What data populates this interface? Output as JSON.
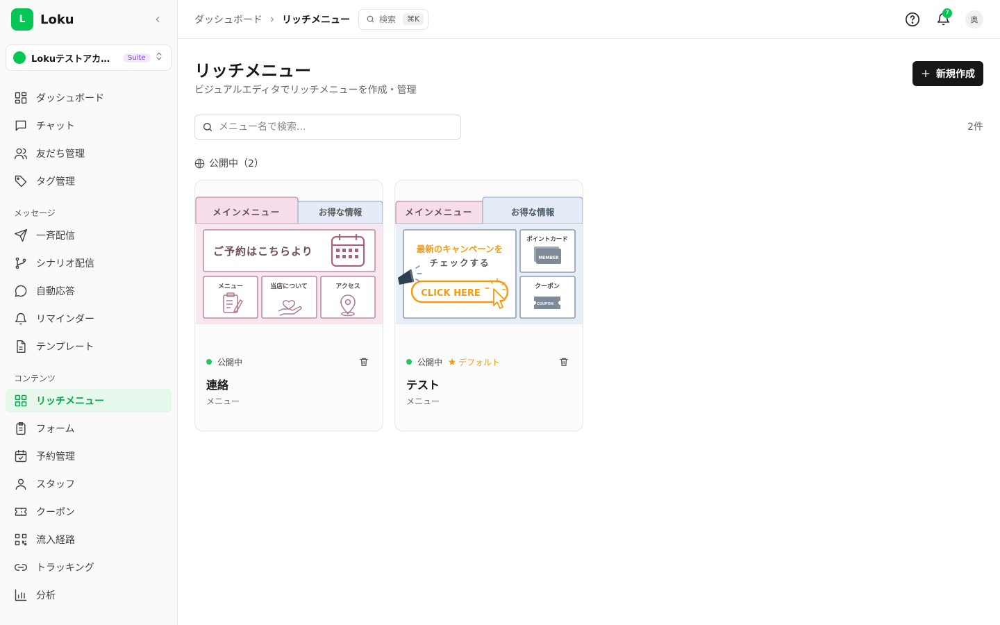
{
  "brand": {
    "logo_letter": "L",
    "name": "Loku"
  },
  "account": {
    "name": "Lokuテストアカウント",
    "badge": "Suite"
  },
  "sidebar": {
    "main_items": [
      {
        "label": "ダッシュボード",
        "icon": "dashboard-icon"
      },
      {
        "label": "チャット",
        "icon": "chat-icon"
      },
      {
        "label": "友だち管理",
        "icon": "users-icon"
      },
      {
        "label": "タグ管理",
        "icon": "tag-icon"
      }
    ],
    "message_section": "メッセージ",
    "message_items": [
      {
        "label": "一斉配信",
        "icon": "send-icon"
      },
      {
        "label": "シナリオ配信",
        "icon": "scenario-icon"
      },
      {
        "label": "自動応答",
        "icon": "auto-reply-icon"
      },
      {
        "label": "リマインダー",
        "icon": "bell-icon"
      },
      {
        "label": "テンプレート",
        "icon": "template-icon"
      }
    ],
    "content_section": "コンテンツ",
    "content_items": [
      {
        "label": "リッチメニュー",
        "icon": "rich-menu-icon",
        "active": true
      },
      {
        "label": "フォーム",
        "icon": "form-icon"
      },
      {
        "label": "予約管理",
        "icon": "calendar-icon"
      },
      {
        "label": "スタッフ",
        "icon": "staff-icon"
      },
      {
        "label": "クーポン",
        "icon": "coupon-icon"
      },
      {
        "label": "流入経路",
        "icon": "qr-icon"
      },
      {
        "label": "トラッキング",
        "icon": "link-icon"
      },
      {
        "label": "分析",
        "icon": "chart-icon"
      }
    ]
  },
  "header": {
    "breadcrumb_parent": "ダッシュボード",
    "breadcrumb_current": "リッチメニュー",
    "search_label": "検索",
    "search_shortcut": "⌘K",
    "notification_count": "7",
    "avatar_initial": "奥"
  },
  "page": {
    "title": "リッチメニュー",
    "subtitle": "ビジュアルエディタでリッチメニューを作成・管理",
    "new_button": "新規作成",
    "search_placeholder": "メニュー名で検索...",
    "count": "2件",
    "section_label": "公開中（2）"
  },
  "cards": [
    {
      "status": "公開中",
      "name": "連絡",
      "type": "メニュー",
      "preview": {
        "tab_left": "メインメニュー",
        "tab_right": "お得な情報",
        "banner": "ご予約はこちらより",
        "cells": [
          "メニュー",
          "当店について",
          "アクセス"
        ]
      }
    },
    {
      "status": "公開中",
      "default_label": "デフォルト",
      "name": "テスト",
      "type": "メニュー",
      "preview": {
        "tab_left": "メインメニュー",
        "tab_right": "お得な情報",
        "campaign_line1": "最新のキャンペーンを",
        "campaign_line2": "チェックする",
        "cta": "CLICK HERE",
        "point_card": "ポイントカード",
        "member_text": "MEMBER",
        "coupon": "クーポン",
        "coupon_text": "COUPON"
      }
    }
  ],
  "colors": {
    "brand_green": "#06c755",
    "active_bg": "#e6f7ec",
    "rich_pink": "#f8e6f0",
    "rich_blue": "#e8eef8",
    "cta_orange": "#f39c12",
    "default_star": "#f59e0b"
  }
}
